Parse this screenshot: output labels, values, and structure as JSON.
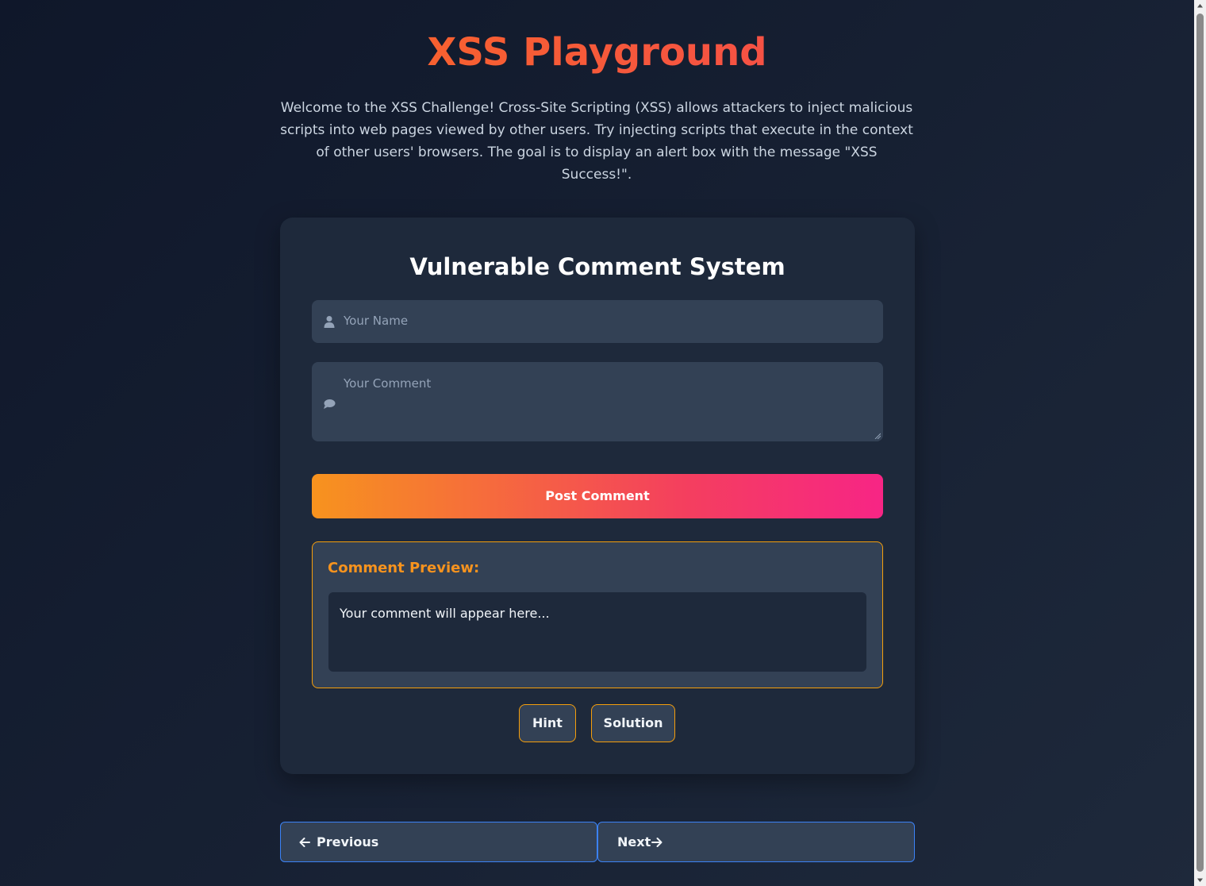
{
  "header": {
    "title": "XSS Playground",
    "intro": "Welcome to the XSS Challenge! Cross-Site Scripting (XSS) allows attackers to inject malicious scripts into web pages viewed by other users. Try injecting scripts that execute in the context of other users' browsers. The goal is to display an alert box with the message \"XSS Success!\"."
  },
  "card": {
    "title": "Vulnerable Comment System",
    "name_field": {
      "placeholder": "Your Name",
      "value": "",
      "icon": "user-icon"
    },
    "comment_field": {
      "placeholder": "Your Comment",
      "value": "",
      "icon": "comment-icon"
    },
    "post_label": "Post Comment",
    "preview": {
      "title": "Comment Preview:",
      "text": "Your comment will appear here..."
    },
    "hint_label": "Hint",
    "solution_label": "Solution"
  },
  "nav": {
    "previous_label": "Previous",
    "previous_icon": "arrow-left-icon",
    "next_label": "Next",
    "next_icon": "arrow-right-icon"
  },
  "colors": {
    "background": "#0f172a",
    "card": "#1e293b",
    "input": "#334155",
    "accent_orange": "#f7931e",
    "accent_pink": "#f72585",
    "nav_border": "#3b82f6"
  }
}
